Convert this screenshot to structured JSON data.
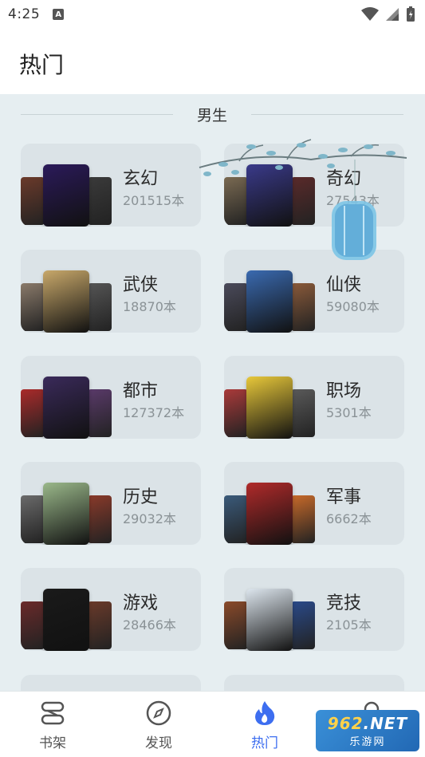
{
  "status_bar": {
    "time": "4:25",
    "notif_icon": "A"
  },
  "header": {
    "title": "热门"
  },
  "section": {
    "title": "男生"
  },
  "categories": [
    {
      "name": "玄幻",
      "count": "201515本",
      "colors": [
        "#6b3a2a",
        "#2b1a5a",
        "#3a3a3a"
      ]
    },
    {
      "name": "奇幻",
      "count": "27543本",
      "colors": [
        "#7a6a52",
        "#3a3a8a",
        "#5a2a2a"
      ]
    },
    {
      "name": "武侠",
      "count": "18870本",
      "colors": [
        "#8a7a6a",
        "#c8a86a",
        "#555"
      ]
    },
    {
      "name": "仙侠",
      "count": "59080本",
      "colors": [
        "#4a4a5a",
        "#3a6ab0",
        "#8a5a3a"
      ]
    },
    {
      "name": "都市",
      "count": "127372本",
      "colors": [
        "#aa2a2a",
        "#3a2a5a",
        "#5a3a6a"
      ]
    },
    {
      "name": "职场",
      "count": "5301本",
      "colors": [
        "#aa3a3a",
        "#e8c83a",
        "#5a5a5a"
      ]
    },
    {
      "name": "历史",
      "count": "29032本",
      "colors": [
        "#6a6a6a",
        "#9ab88a",
        "#8a3a2a"
      ]
    },
    {
      "name": "军事",
      "count": "6662本",
      "colors": [
        "#3a5a7a",
        "#b02a2a",
        "#c86a2a"
      ]
    },
    {
      "name": "游戏",
      "count": "28466本",
      "colors": [
        "#6a2a2a",
        "#1a1a1a",
        "#6a3a2a"
      ]
    },
    {
      "name": "竞技",
      "count": "2105本",
      "colors": [
        "#8a4a2a",
        "#dde6ee",
        "#2a4a8a"
      ]
    }
  ],
  "nav": {
    "bookshelf": "书架",
    "discover": "发现",
    "hot": "热门",
    "me": "我的"
  },
  "watermark": {
    "top_a": "962",
    "top_b": ".NET",
    "bottom": "乐游网"
  },
  "accent_color": "#3d6ef0"
}
